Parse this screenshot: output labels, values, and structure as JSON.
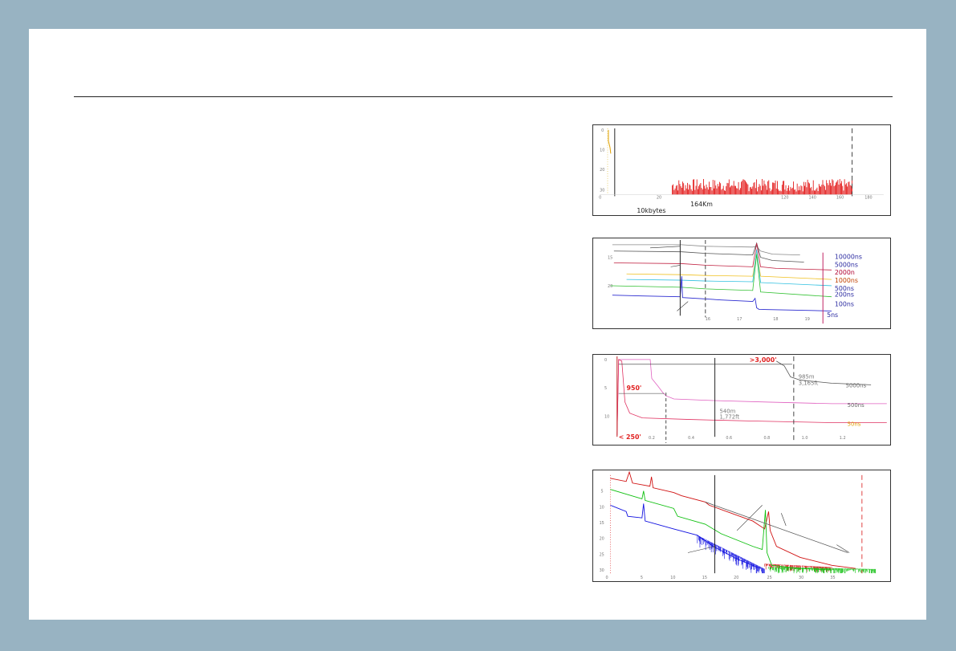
{
  "panel1": {
    "distance_label": "164Km",
    "size_label": "10kbytes",
    "x_ticks": [
      "0",
      "20",
      "120",
      "140",
      "160",
      "180"
    ],
    "y_ticks": [
      "0",
      "10",
      "20",
      "30"
    ],
    "colors": {
      "noise": "#e00000",
      "trace": "#e0a000"
    }
  },
  "panel2": {
    "pulse_labels": [
      "10000ns",
      "5000ns",
      "2000n",
      "1000ns",
      "500ns",
      "200ns",
      "100ns",
      "5ns"
    ],
    "pulse_colors": [
      "#2a2aa0",
      "#2a2aa0",
      "#b00030",
      "#c04000",
      "#2aa0c0",
      "#2aa030",
      "#2a2aa0",
      "#a02080"
    ],
    "x_ticks": [
      "16",
      "17",
      "18",
      "19"
    ],
    "y_ticks": [
      "15",
      "20"
    ]
  },
  "panel3": {
    "labels": {
      "dist_3000": ">3,000'",
      "dist_950": "950'",
      "dist_250": "< 250'",
      "meas1_m": "985m",
      "meas1_ft": "3,165ft",
      "meas2_m": "540m",
      "meas2_ft": "1,772ft",
      "pulse_5000": "5000ns",
      "pulse_500": "500ns",
      "pulse_50": "50ns"
    },
    "x_ticks": [
      "0.2",
      "0.4",
      "0.6",
      "0.8",
      "1.0",
      "1.2"
    ],
    "y_ticks": [
      "0",
      "5",
      "10"
    ]
  },
  "panel4": {
    "x_ticks": [
      "0",
      "5",
      "10",
      "15",
      "20",
      "25",
      "30",
      "35"
    ],
    "y_ticks": [
      "5",
      "10",
      "15",
      "20",
      "25",
      "30"
    ],
    "colors": {
      "red": "#d01010",
      "green": "#10c010",
      "blue": "#1010e0"
    }
  }
}
